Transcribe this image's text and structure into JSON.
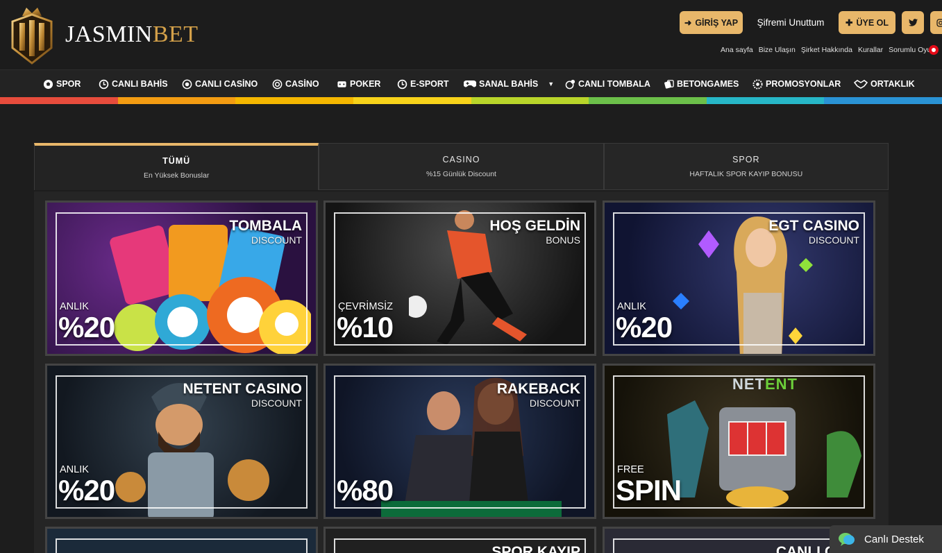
{
  "brand": {
    "name_white": "JASMIN",
    "name_gold": "BET"
  },
  "header": {
    "login_label": "GİRİŞ YAP",
    "forgot_label": "Şifremi Unuttum",
    "register_label": "ÜYE OL"
  },
  "toplinks": [
    "Ana sayfa",
    "Bize Ulaşın",
    "Şirket Hakkında",
    "Kurallar",
    "Sorumlu Oyun"
  ],
  "nav": [
    {
      "label": "SPOR",
      "icon": "soccer-ball-icon"
    },
    {
      "label": "CANLI BAHİS",
      "icon": "clock-icon"
    },
    {
      "label": "CANLI CASİNO",
      "icon": "chip-icon"
    },
    {
      "label": "CASİNO",
      "icon": "chip-icon"
    },
    {
      "label": "POKER",
      "icon": "cards-icon"
    },
    {
      "label": "E-SPORT",
      "icon": "clock-icon"
    },
    {
      "label": "SANAL BAHİS",
      "icon": "gamepad-icon"
    },
    {
      "label": "CANLI TOMBALA",
      "icon": "tombala-icon"
    },
    {
      "label": "BETONGAMES",
      "icon": "cards-icon"
    },
    {
      "label": "PROMOSYONLAR",
      "icon": "gear-icon"
    },
    {
      "label": "ORTAKLIK",
      "icon": "handshake-icon"
    }
  ],
  "color_bar": [
    "#e74c3c",
    "#f39c12",
    "#f5b700",
    "#f7d21a",
    "#b9d52a",
    "#6cc04a",
    "#27b7c7",
    "#2a93d5"
  ],
  "tabs": [
    {
      "title": "TÜMÜ",
      "subtitle": "En Yüksek Bonuslar"
    },
    {
      "title": "CASINO",
      "subtitle": "%15 Günlük Discount"
    },
    {
      "title": "SPOR",
      "subtitle": "HAFTALIK SPOR KAYIP BONUSU"
    }
  ],
  "cards": [
    {
      "title": "TOMBALA",
      "sub": "DISCOUNT",
      "small": "ANLIK",
      "big": "%20"
    },
    {
      "title": "HOŞ GELDİN",
      "sub": "BONUS",
      "small": "ÇEVRİMSİZ",
      "big": "%10"
    },
    {
      "title": "EGT CASINO",
      "sub": "DISCOUNT",
      "small": "ANLIK",
      "big": "%20"
    },
    {
      "title": "NETENT CASINO",
      "sub": "DISCOUNT",
      "small": "ANLIK",
      "big": "%20"
    },
    {
      "title": "RAKEBACK",
      "sub": "DISCOUNT",
      "small": "",
      "big": "%80"
    },
    {
      "title": "",
      "sub": "",
      "small": "FREE",
      "big": "SPIN",
      "logo_a": "NET",
      "logo_b": "ENT"
    },
    {
      "title": "",
      "sub": "",
      "small": "",
      "big": ""
    },
    {
      "title": "SPOR KAYIP",
      "sub": "",
      "small": "",
      "big": ""
    },
    {
      "title": "CANLI CASI",
      "sub": "",
      "small": "",
      "big": ""
    }
  ],
  "support": {
    "label": "Canlı Destek"
  }
}
